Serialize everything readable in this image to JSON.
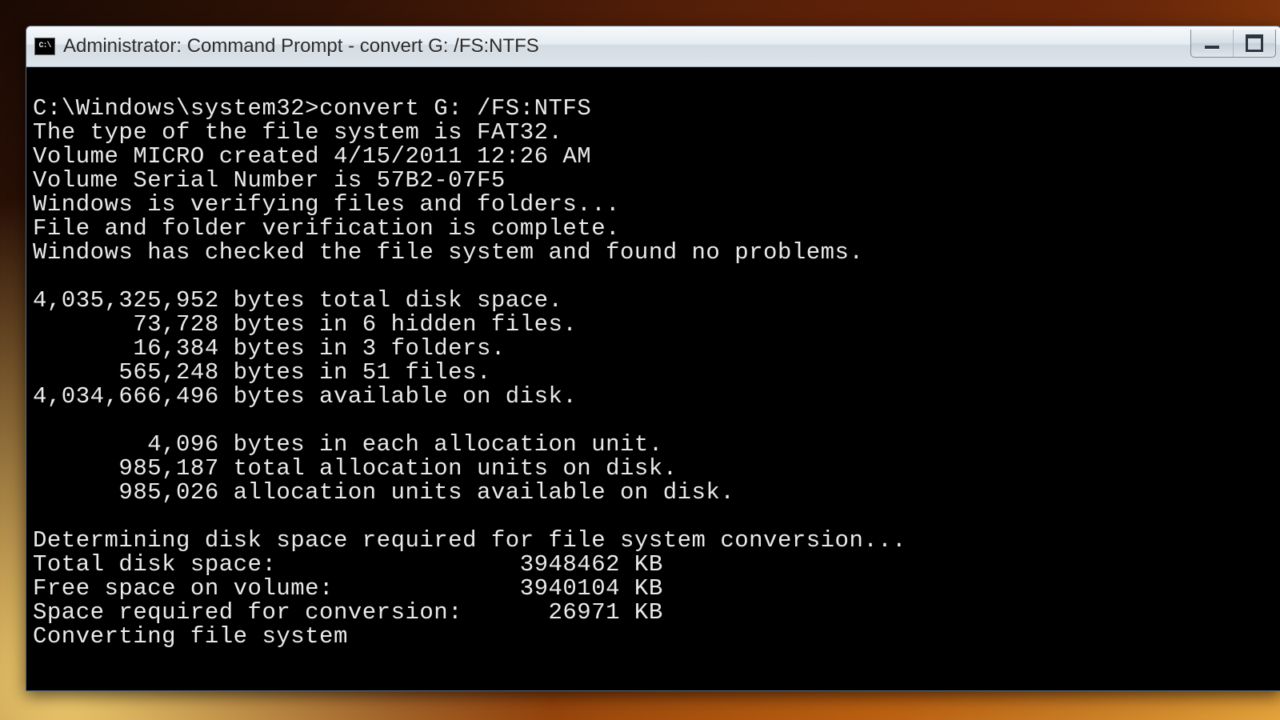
{
  "window": {
    "icon_label": "C:\\",
    "title": "Administrator: Command Prompt - convert  G: /FS:NTFS"
  },
  "prompt": {
    "path": "C:\\Windows\\system32>",
    "command": "convert G: /FS:NTFS"
  },
  "output_lines": [
    "The type of the file system is FAT32.",
    "Volume MICRO created 4/15/2011 12:26 AM",
    "Volume Serial Number is 57B2-07F5",
    "Windows is verifying files and folders...",
    "File and folder verification is complete.",
    "Windows has checked the file system and found no problems.",
    "",
    "4,035,325,952 bytes total disk space.",
    "       73,728 bytes in 6 hidden files.",
    "       16,384 bytes in 3 folders.",
    "      565,248 bytes in 51 files.",
    "4,034,666,496 bytes available on disk.",
    "",
    "        4,096 bytes in each allocation unit.",
    "      985,187 total allocation units on disk.",
    "      985,026 allocation units available on disk.",
    "",
    "Determining disk space required for file system conversion...",
    "Total disk space:                 3948462 KB",
    "Free space on volume:             3940104 KB",
    "Space required for conversion:      26971 KB",
    "Converting file system"
  ]
}
